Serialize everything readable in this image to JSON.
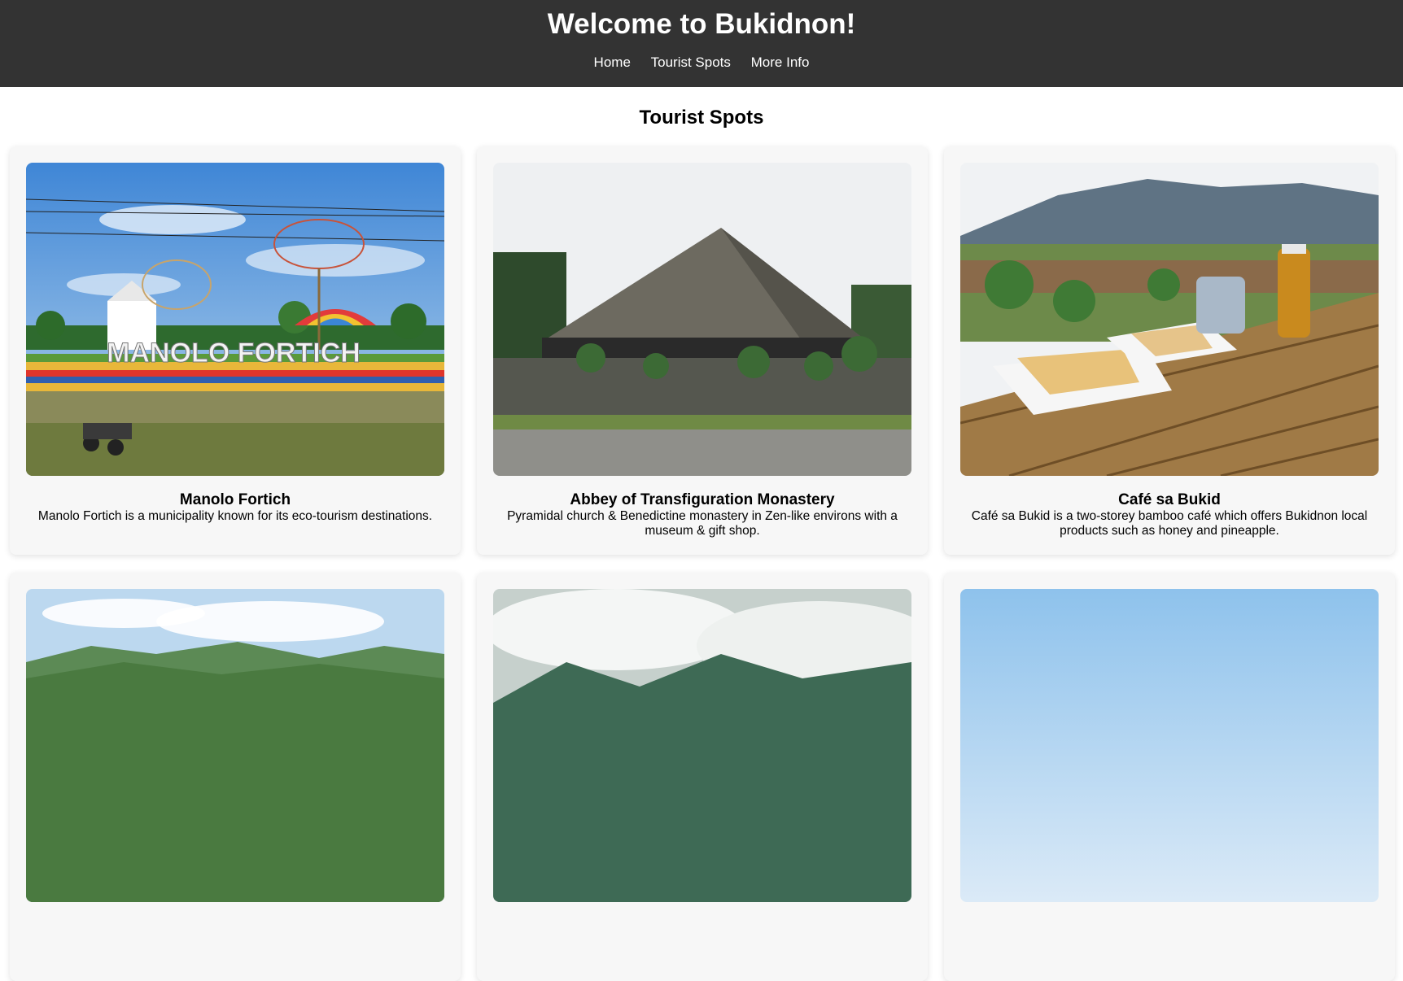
{
  "header": {
    "title": "Welcome to Bukidnon!",
    "nav": [
      "Home",
      "Tourist Spots",
      "More Info"
    ]
  },
  "main": {
    "section_title": "Tourist Spots",
    "cards": [
      {
        "title": "Manolo Fortich",
        "description": "Manolo Fortich is a municipality known for its eco-tourism destinations.",
        "image_sign_text": "MANOLO FORTICH"
      },
      {
        "title": "Abbey of Transfiguration Monastery",
        "description": "Pyramidal church & Benedictine monastery in Zen-like environs with a museum & gift shop."
      },
      {
        "title": "Café sa Bukid",
        "description": "Café sa Bukid is a two-storey bamboo café which offers Bukidnon local products such as honey and pineapple."
      },
      {
        "title": "",
        "description": ""
      },
      {
        "title": "",
        "description": ""
      },
      {
        "title": "",
        "description": ""
      }
    ]
  },
  "colors": {
    "header_bg": "#333333",
    "card_bg": "#f7f7f7",
    "text": "#000000"
  }
}
